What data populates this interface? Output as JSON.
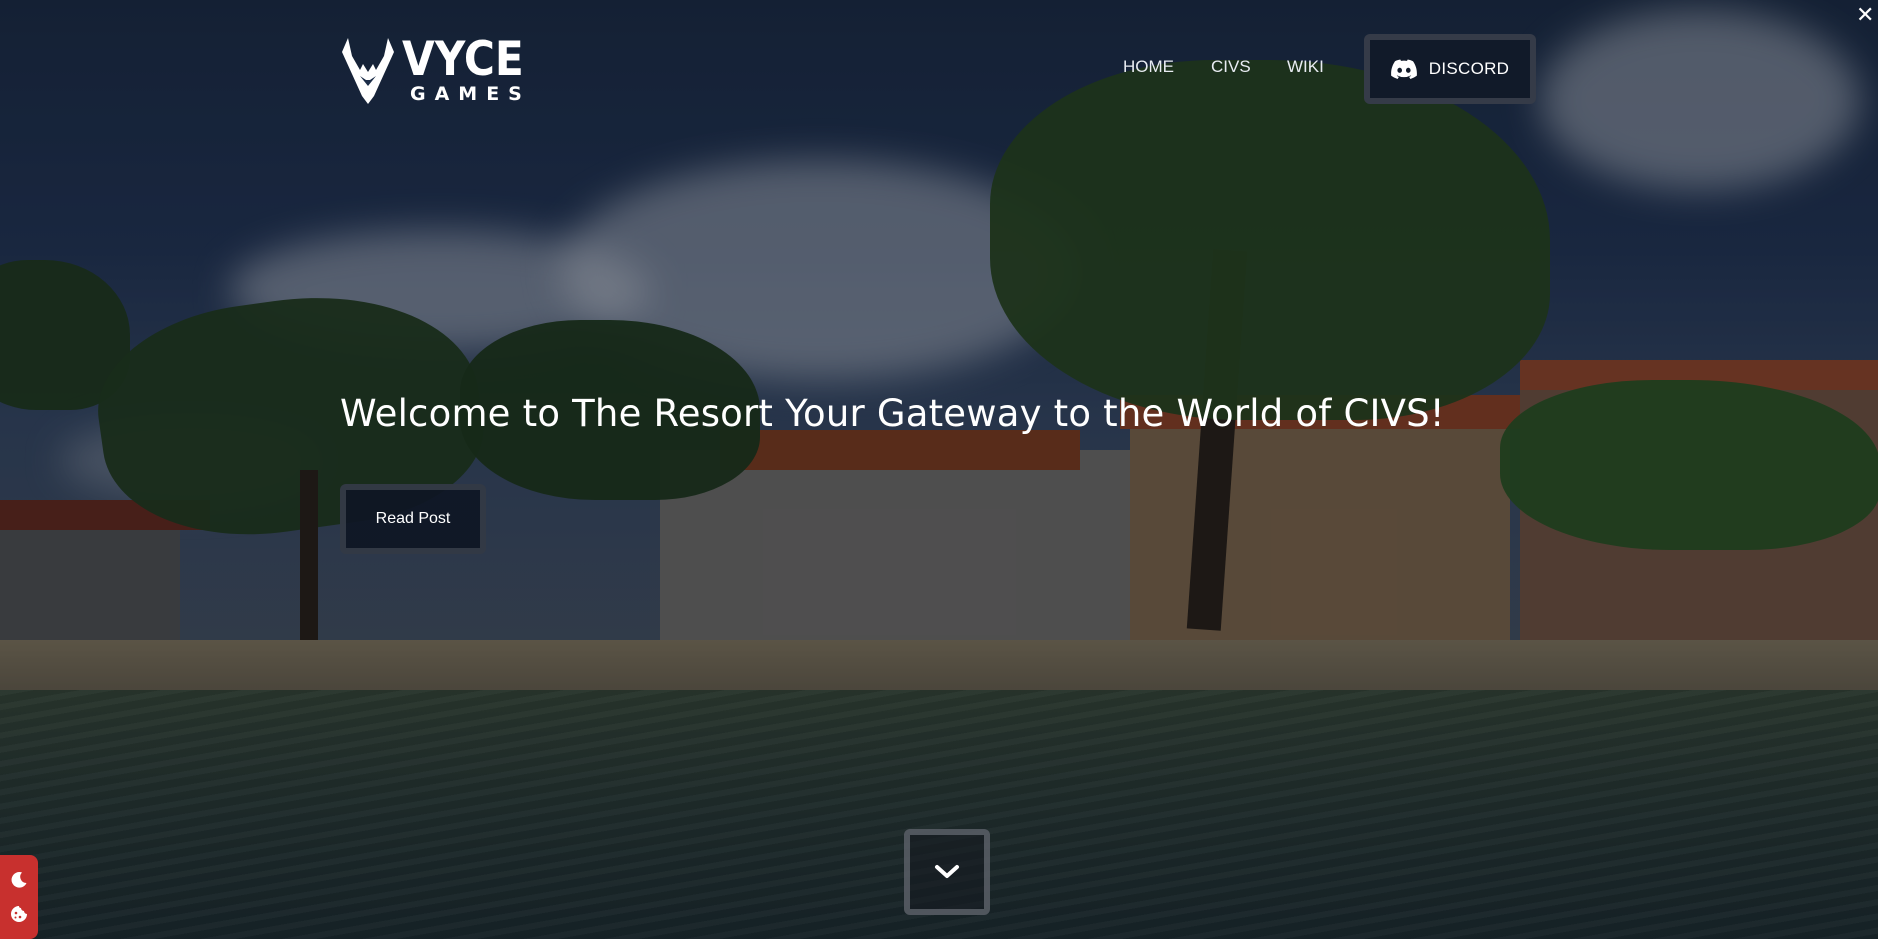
{
  "header": {
    "logo_title": "VYCE",
    "logo_subtitle": "GAMES",
    "nav": {
      "home": "HOME",
      "civs": "CIVS",
      "wiki": "WIKI"
    },
    "discord_label": "DISCORD",
    "close_glyph": "✕"
  },
  "hero": {
    "title": "Welcome to The Resort Your Gateway to the World of CIVS!",
    "read_button_label": "Read Post"
  },
  "icons": {
    "logo": "vyce-logo-icon",
    "discord": "discord-icon",
    "scroll": "chevron-down-icon",
    "dark_mode": "moon-icon",
    "cookies": "cookie-icon",
    "close": "close-icon"
  },
  "colors": {
    "accent_widget": "#c8302e",
    "button_bg": "#111a29"
  }
}
